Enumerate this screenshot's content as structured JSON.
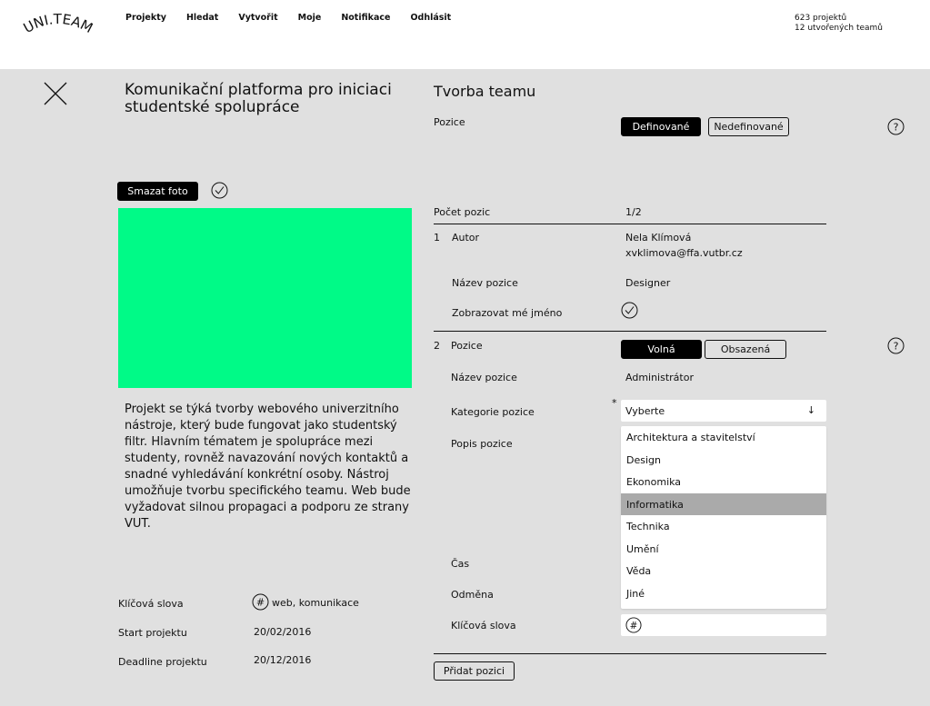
{
  "header": {
    "logo_text": "UNI.TEAM",
    "nav": [
      "Projekty",
      "Hledat",
      "Vytvořit",
      "Moje",
      "Notifikace",
      "Odhlásit"
    ],
    "stats": [
      "623 projektů",
      "12 utvořených teamů"
    ]
  },
  "project": {
    "title": "Komunikační platforma pro iniciaci studentské spolupráce",
    "delete_photo_label": "Smazat foto",
    "description": "Projekt se týká tvorby webového univerzitního nástroje, který bude fungovat jako studentský filtr. Hlavním tématem je spolupráce mezi studenty, rovněž navazování nových kontaktů a snadné vyhledávání konkrétní osoby. Nástroj umožňuje tvorbu specifického teamu. Web bude vyžadovat silnou propagaci a podporu ze strany VUT.",
    "keywords_label": "Klíčová slova",
    "keywords_value": "web, komunikace",
    "start_label": "Start projektu",
    "start_value": "20/02/2016",
    "deadline_label": "Deadline projektu",
    "deadline_value": "20/12/2016",
    "photo_color": "#00fa87"
  },
  "team": {
    "title": "Tvorba teamu",
    "positions_label": "Pozice",
    "defined_label": "Definované",
    "undefined_label": "Nedefinované",
    "count_label": "Počet pozic",
    "count_value": "1/2",
    "pos1": {
      "number": "1",
      "role_label": "Autor",
      "author_name": "Nela Klímová",
      "author_email": "xvklimova@ffa.vutbr.cz",
      "name_label": "Název pozice",
      "name_value": "Designer",
      "show_name_label": "Zobrazovat mé jméno"
    },
    "pos2": {
      "number": "2",
      "role_label": "Pozice",
      "free_label": "Volná",
      "taken_label": "Obsazená",
      "name_label": "Název pozice",
      "name_value": "Administrátor",
      "category_label": "Kategorie pozice",
      "required_mark": "*",
      "select_value": "Vyberte",
      "select_arrow": "↓",
      "options": [
        "Architektura a stavitelství",
        "Design",
        "Ekonomika",
        "Informatika",
        "Technika",
        "Umění",
        "Věda",
        "Jiné"
      ],
      "selected_option": "Informatika",
      "description_label": "Popis pozice",
      "time_label": "Čas",
      "reward_label": "Odměna",
      "keywords_label": "Klíčová slova"
    },
    "add_position_label": "Přidat pozici"
  }
}
